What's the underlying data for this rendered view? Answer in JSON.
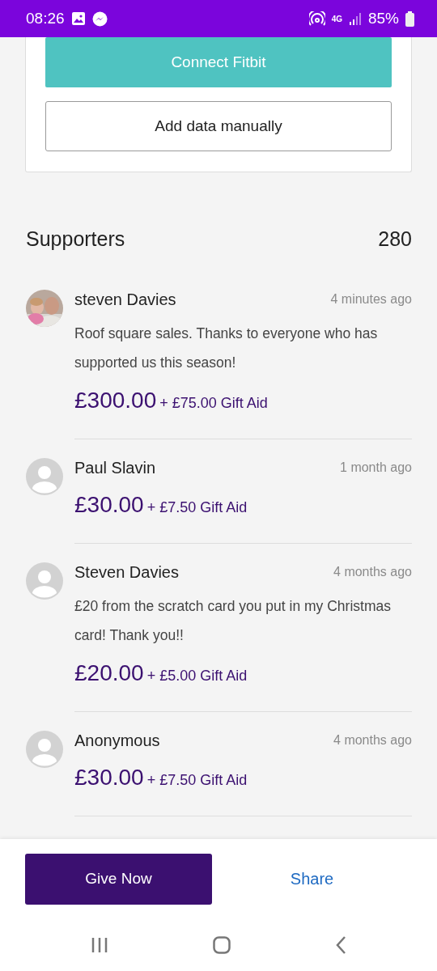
{
  "status_bar": {
    "time": "08:26",
    "battery": "85%",
    "network": "4G"
  },
  "tracker_card": {
    "buttons": [
      {
        "label": "Connect Fitbit",
        "kind": "primary"
      },
      {
        "label": "Add data manually",
        "kind": "outline"
      }
    ]
  },
  "supporters": {
    "title": "Supporters",
    "count": "280",
    "items": [
      {
        "name": "steven Davies",
        "time": "4 minutes ago",
        "message": "Roof square sales. Thanks to everyone who has supported us this season!",
        "amount": "£300.00",
        "gift_aid": "+ £75.00 Gift Aid"
      },
      {
        "name": "Paul Slavin",
        "time": "1 month ago",
        "kind": "default",
        "amount": "£30.00",
        "gift_aid": "+ £7.50 Gift Aid"
      },
      {
        "name": "Steven Davies",
        "time": "4 months ago",
        "kind": "default",
        "message": "£20 from the scratch card you put in my Christmas card! Thank you!!",
        "amount": "£20.00",
        "gift_aid": "+ £5.00 Gift Aid"
      },
      {
        "name": "Anonymous",
        "time": "4 months ago",
        "kind": "default",
        "amount": "£30.00",
        "gift_aid": "+ £7.50 Gift Aid"
      }
    ]
  },
  "bottom_bar": {
    "give_button": "Give Now",
    "share_link": "Share"
  }
}
